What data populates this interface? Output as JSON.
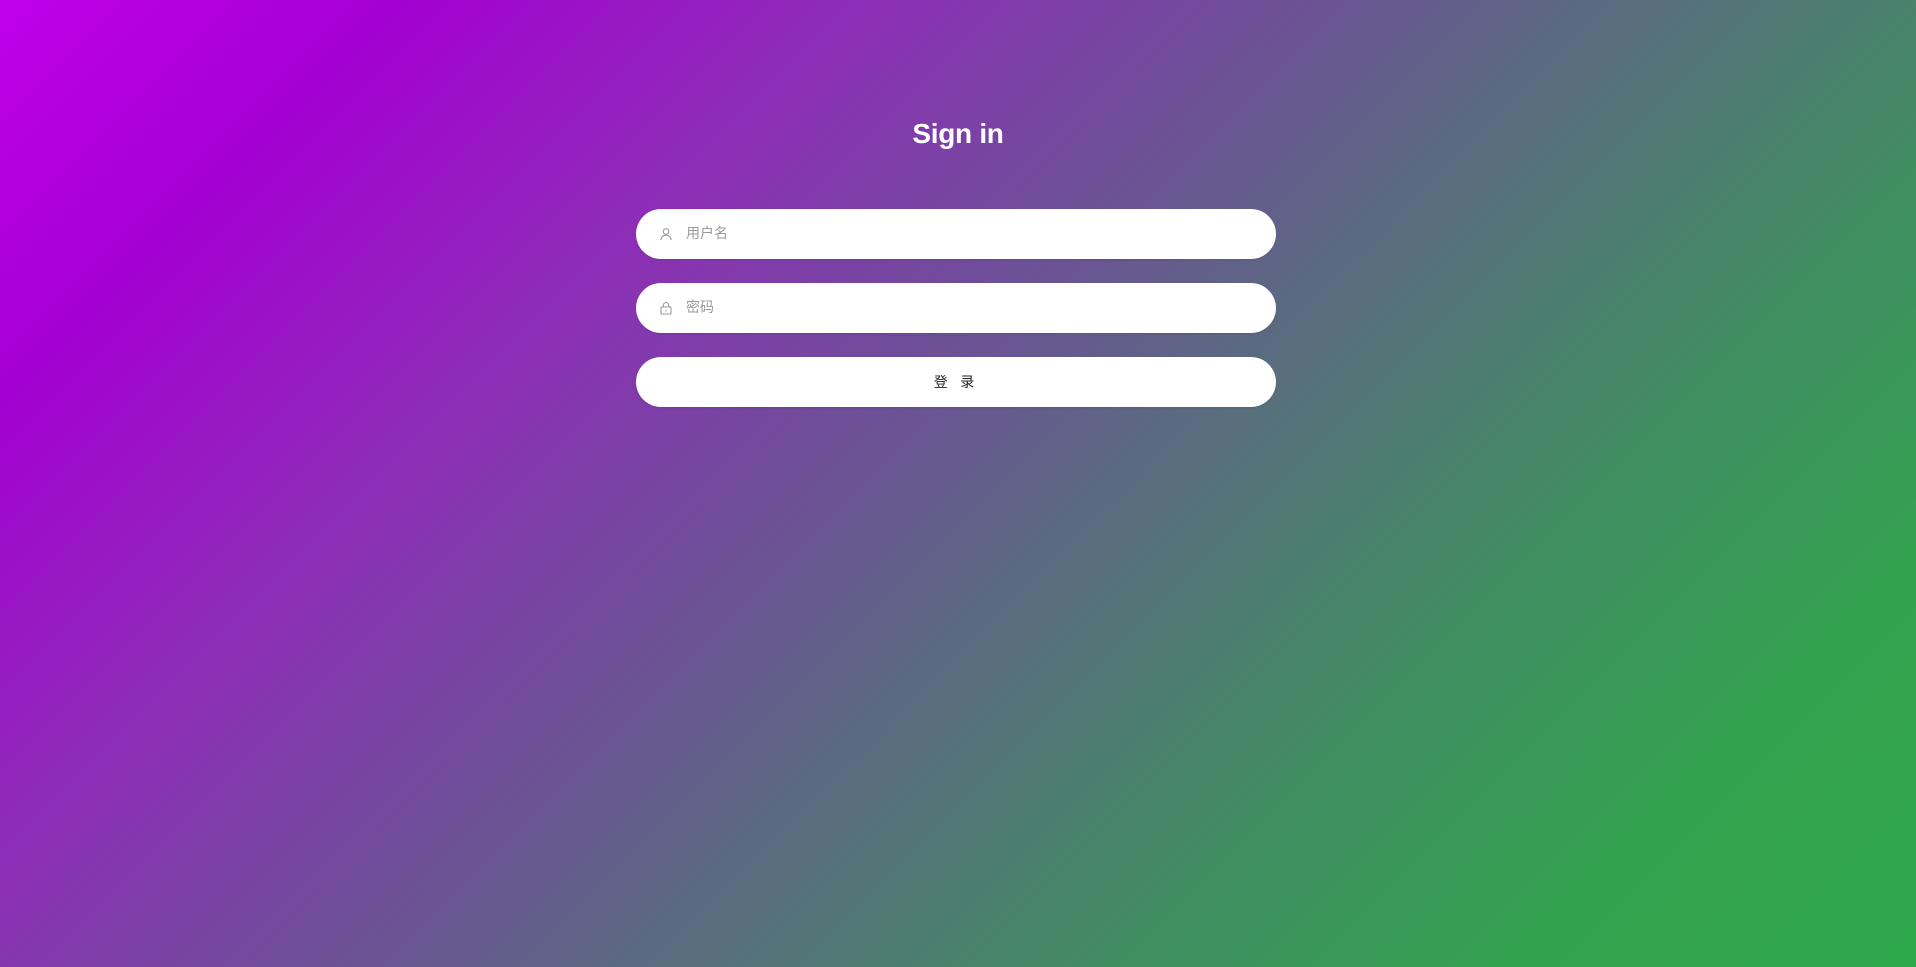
{
  "page": {
    "title": "Sign in"
  },
  "form": {
    "username": {
      "placeholder": "用户名",
      "value": "",
      "icon": "user-icon"
    },
    "password": {
      "placeholder": "密码",
      "value": "",
      "icon": "lock-icon"
    },
    "submit_label": "登 录"
  },
  "colors": {
    "gradient_start": "#c000ea",
    "gradient_end": "#2fa84c",
    "field_background": "#ffffff",
    "title_text": "#ffffff"
  }
}
